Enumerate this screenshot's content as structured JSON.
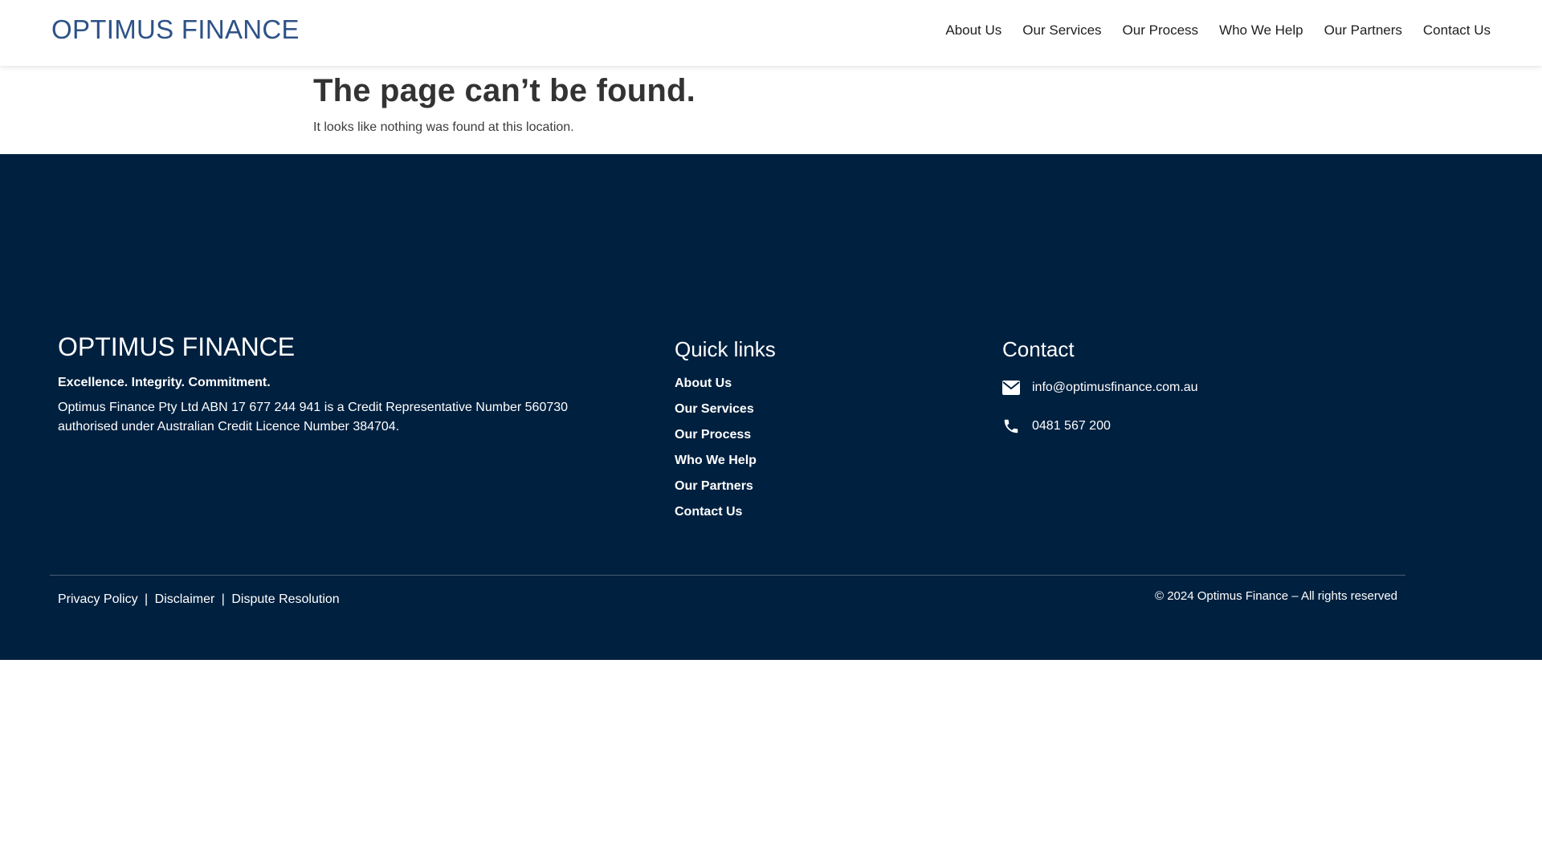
{
  "header": {
    "brand": "OPTIMUS FINANCE",
    "nav": [
      "About Us",
      "Our Services",
      "Our Process",
      "Who We Help",
      "Our Partners",
      "Contact Us"
    ]
  },
  "main": {
    "title": "The page can’t be found.",
    "message": "It looks like nothing was found at this location."
  },
  "footer": {
    "brand": "OPTIMUS FINANCE",
    "tagline": "Excellence. Integrity. Commitment.",
    "description": "Optimus Finance Pty Ltd ABN 17 677 244 941 is a Credit Representative Number 560730 authorised under Australian Credit Licence Number 384704.",
    "quick_links_heading": "Quick links",
    "quick_links": [
      "About Us",
      "Our Services",
      "Our Process",
      "Who We Help",
      "Our Partners",
      "Contact Us"
    ],
    "contact_heading": "Contact",
    "email": "info@optimusfinance.com.au",
    "email_icon": "envelope-icon",
    "phone": "0481 567 200",
    "phone_icon": "phone-icon",
    "legal": {
      "privacy": "Privacy Policy",
      "separator": "|",
      "disclaimer": "Disclaimer",
      "dispute": "Dispute Resolution"
    },
    "copyright": "© 2024 Optimus Finance – All rights reserved"
  },
  "colors": {
    "brand_blue": "#2d5286",
    "footer_bg": "#00203f",
    "heading_text": "#333333"
  }
}
